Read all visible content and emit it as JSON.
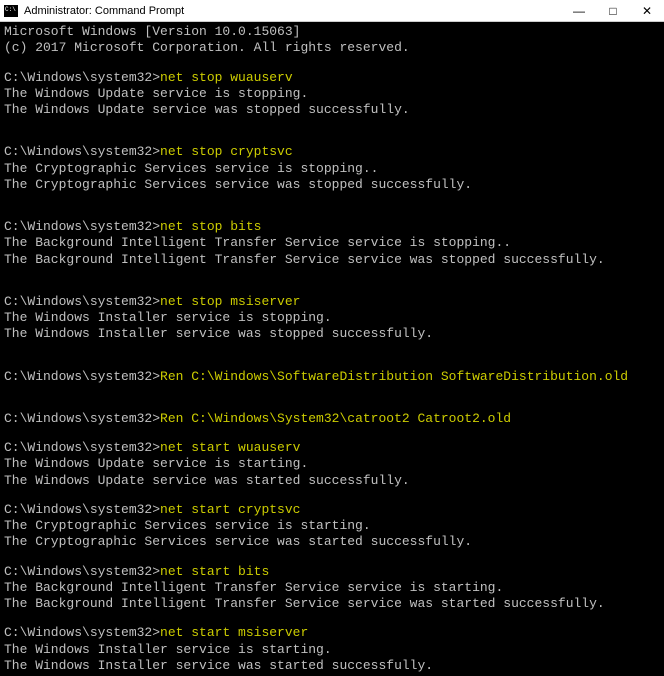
{
  "titlebar": {
    "title": "Administrator: Command Prompt",
    "min": "—",
    "max": "□",
    "close": "✕"
  },
  "header": {
    "line1": "Microsoft Windows [Version 10.0.15063]",
    "line2": "(c) 2017 Microsoft Corporation. All rights reserved."
  },
  "prompt": "C:\\Windows\\system32>",
  "blocks": [
    {
      "cmd": "net stop wuauserv",
      "out": [
        "The Windows Update service is stopping.",
        "The Windows Update service was stopped successfully."
      ],
      "blanks_before": 1,
      "blanks_after": 2
    },
    {
      "cmd": "net stop cryptsvc",
      "out": [
        "The Cryptographic Services service is stopping..",
        "The Cryptographic Services service was stopped successfully."
      ],
      "blanks_before": 0,
      "blanks_after": 2
    },
    {
      "cmd": "net stop bits",
      "out": [
        "The Background Intelligent Transfer Service service is stopping..",
        "The Background Intelligent Transfer Service service was stopped successfully."
      ],
      "blanks_before": 0,
      "blanks_after": 2
    },
    {
      "cmd": "net stop msiserver",
      "out": [
        "The Windows Installer service is stopping.",
        "The Windows Installer service was stopped successfully."
      ],
      "blanks_before": 0,
      "blanks_after": 2
    },
    {
      "cmd": "Ren C:\\Windows\\SoftwareDistribution SoftwareDistribution.old",
      "out": [],
      "blanks_before": 0,
      "blanks_after": 2
    },
    {
      "cmd": "Ren C:\\Windows\\System32\\catroot2 Catroot2.old",
      "out": [],
      "blanks_before": 0,
      "blanks_after": 1
    },
    {
      "cmd": "net start wuauserv",
      "out": [
        "The Windows Update service is starting.",
        "The Windows Update service was started successfully."
      ],
      "blanks_before": 0,
      "blanks_after": 1
    },
    {
      "cmd": "net start cryptsvc",
      "out": [
        "The Cryptographic Services service is starting.",
        "The Cryptographic Services service was started successfully."
      ],
      "blanks_before": 0,
      "blanks_after": 1
    },
    {
      "cmd": "net start bits",
      "out": [
        "The Background Intelligent Transfer Service service is starting.",
        "The Background Intelligent Transfer Service service was started successfully."
      ],
      "blanks_before": 0,
      "blanks_after": 1
    },
    {
      "cmd": "net start msiserver",
      "out": [
        "The Windows Installer service is starting.",
        "The Windows Installer service was started successfully."
      ],
      "blanks_before": 0,
      "blanks_after": 0
    }
  ]
}
